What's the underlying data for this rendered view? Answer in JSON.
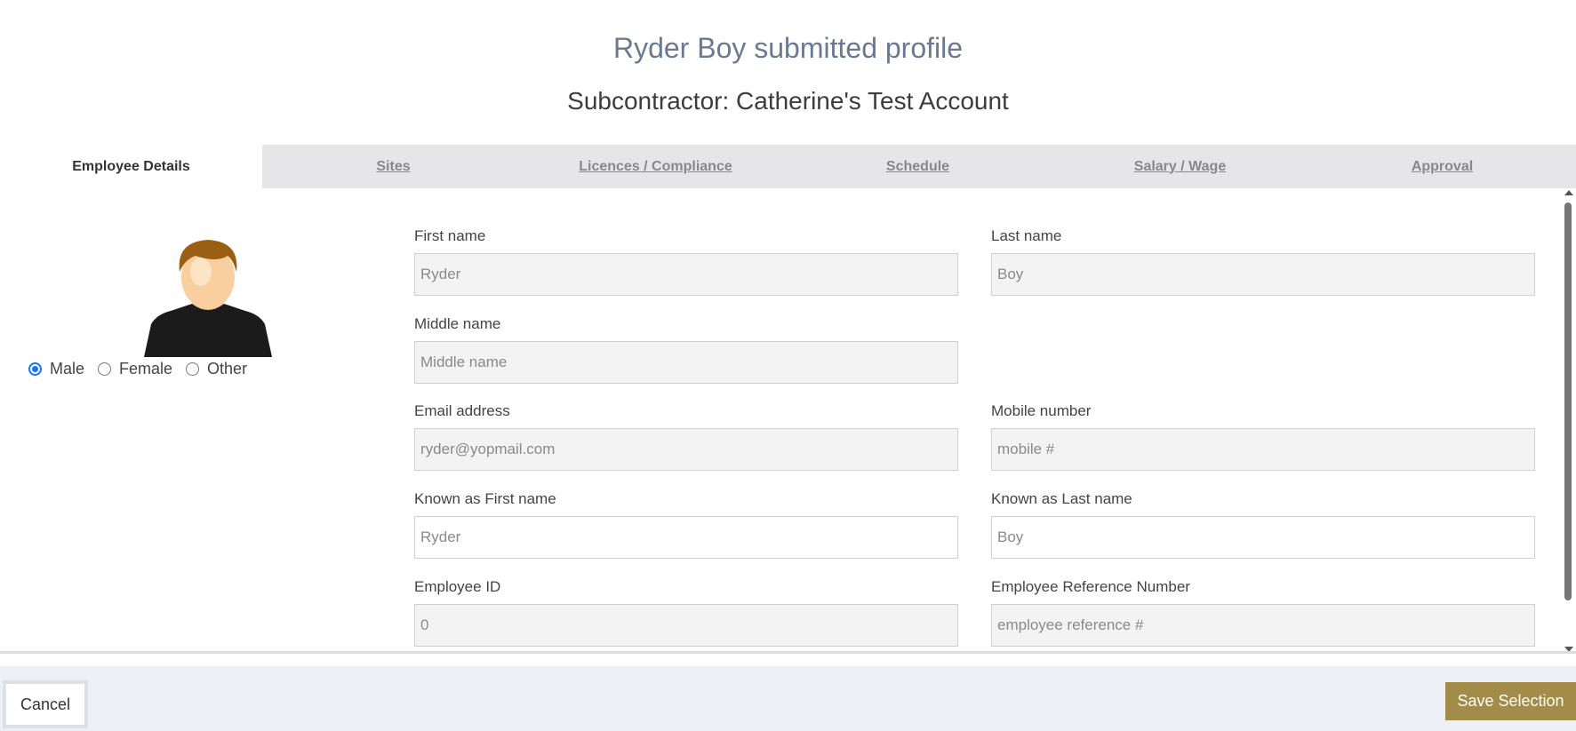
{
  "header": {
    "title": "Ryder Boy submitted profile",
    "subtitle": "Subcontractor: Catherine's Test Account"
  },
  "tabs": [
    {
      "label": "Employee Details",
      "active": true
    },
    {
      "label": "Sites",
      "active": false
    },
    {
      "label": "Licences / Compliance",
      "active": false
    },
    {
      "label": "Schedule",
      "active": false
    },
    {
      "label": "Salary / Wage",
      "active": false
    },
    {
      "label": "Approval",
      "active": false
    }
  ],
  "avatar": {
    "icon": "user-avatar-icon"
  },
  "gender": {
    "selected": "Male",
    "options": [
      "Male",
      "Female",
      "Other"
    ]
  },
  "fields": {
    "first_name": {
      "label": "First name",
      "value": "Ryder",
      "placeholder": ""
    },
    "last_name": {
      "label": "Last name",
      "value": "Boy",
      "placeholder": ""
    },
    "middle_name": {
      "label": "Middle name",
      "value": "",
      "placeholder": "Middle name"
    },
    "email": {
      "label": "Email address",
      "value": "ryder@yopmail.com",
      "placeholder": ""
    },
    "mobile": {
      "label": "Mobile number",
      "value": "",
      "placeholder": "mobile #"
    },
    "known_first": {
      "label": "Known as First name",
      "value": "",
      "placeholder": "Ryder"
    },
    "known_last": {
      "label": "Known as Last name",
      "value": "",
      "placeholder": "Boy"
    },
    "employee_id": {
      "label": "Employee ID",
      "value": "0",
      "placeholder": ""
    },
    "employee_ref": {
      "label": "Employee Reference Number",
      "value": "",
      "placeholder": "employee reference #"
    }
  },
  "footer": {
    "cancel_label": "Cancel",
    "save_label": "Save Selection"
  },
  "colors": {
    "accent": "#a38c4a",
    "title": "#6a7891",
    "radio": "#1a73e8"
  }
}
